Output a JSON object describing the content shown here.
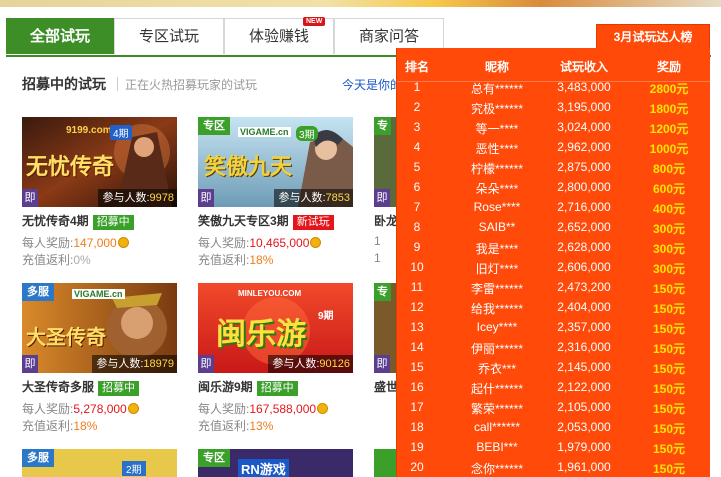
{
  "tabs": [
    {
      "label": "全部试玩",
      "active": true
    },
    {
      "label": "专区试玩",
      "active": false
    },
    {
      "label": "体验赚钱",
      "active": false,
      "badge": "NEW"
    },
    {
      "label": "商家问答",
      "active": false
    }
  ],
  "ranking_tab": "3月试玩达人榜",
  "section": {
    "title": "招募中的试玩",
    "subtitle": "正在火热招募玩家的试玩",
    "today_link": "今天是你的"
  },
  "labels": {
    "participants": "参与人数:",
    "reward": "每人奖励:",
    "rebate": "充值返利:",
    "ji": "即"
  },
  "cards": [
    {
      "name": "无忧传奇4期",
      "status": "招募中",
      "participants": "9978",
      "reward": "147,000",
      "rebate": "0%",
      "badge": "",
      "art_text": "无忧传奇",
      "period": "4期",
      "logo": "9199.com"
    },
    {
      "name": "笑傲九天专区3期",
      "status": "新试玩",
      "participants": "7853",
      "reward": "10,465,000",
      "rebate": "18%",
      "badge": "专区",
      "art_text": "笑傲九天",
      "period": "3期",
      "logo": "VIGAME.cn"
    },
    {
      "name": "大圣传奇多服",
      "status": "招募中",
      "participants": "18979",
      "reward": "5,278,000",
      "rebate": "18%",
      "badge": "多服",
      "art_text": "大圣传奇",
      "period": "",
      "logo": "VIGAME.cn"
    },
    {
      "name": "闽乐游9期",
      "status": "招募中",
      "participants": "90126",
      "reward": "167,588,000",
      "rebate": "13%",
      "badge": "",
      "art_text": "闽乐游",
      "period": "9期",
      "logo": "MINLEYOU.COM"
    }
  ],
  "partial_cards": [
    {
      "name": "卧龙",
      "reward": "1",
      "rebate": "1",
      "badge": "专"
    },
    {
      "name": "盛世",
      "reward": "",
      "rebate": "",
      "badge": "专"
    }
  ],
  "bottom_row": [
    {
      "badge": "多服",
      "period": "2期"
    },
    {
      "badge": "专区",
      "logo": "RN游戏"
    }
  ],
  "leaderboard": {
    "headers": [
      "排名",
      "昵称",
      "试玩收入",
      "奖励"
    ],
    "rows": [
      {
        "rank": "1",
        "name": "总有******",
        "income": "3,483,000",
        "reward": "2800元"
      },
      {
        "rank": "2",
        "name": "究极******",
        "income": "3,195,000",
        "reward": "1800元"
      },
      {
        "rank": "3",
        "name": "等一****",
        "income": "3,024,000",
        "reward": "1200元"
      },
      {
        "rank": "4",
        "name": "恶性****",
        "income": "2,962,000",
        "reward": "1000元"
      },
      {
        "rank": "5",
        "name": "柠檬******",
        "income": "2,875,000",
        "reward": "800元"
      },
      {
        "rank": "6",
        "name": "朵朵****",
        "income": "2,800,000",
        "reward": "600元"
      },
      {
        "rank": "7",
        "name": "Rose****",
        "income": "2,716,000",
        "reward": "400元"
      },
      {
        "rank": "8",
        "name": "SAIB**",
        "income": "2,652,000",
        "reward": "300元"
      },
      {
        "rank": "9",
        "name": "我是****",
        "income": "2,628,000",
        "reward": "300元"
      },
      {
        "rank": "10",
        "name": "旧灯****",
        "income": "2,606,000",
        "reward": "300元"
      },
      {
        "rank": "11",
        "name": "李雷******",
        "income": "2,473,200",
        "reward": "150元"
      },
      {
        "rank": "12",
        "name": "给我******",
        "income": "2,404,000",
        "reward": "150元"
      },
      {
        "rank": "13",
        "name": "Icey****",
        "income": "2,357,000",
        "reward": "150元"
      },
      {
        "rank": "14",
        "name": "伊丽******",
        "income": "2,316,000",
        "reward": "150元"
      },
      {
        "rank": "15",
        "name": "乔衣***",
        "income": "2,145,000",
        "reward": "150元"
      },
      {
        "rank": "16",
        "name": "起什******",
        "income": "2,122,000",
        "reward": "150元"
      },
      {
        "rank": "17",
        "name": "繁荣******",
        "income": "2,105,000",
        "reward": "150元"
      },
      {
        "rank": "18",
        "name": "call******",
        "income": "2,053,000",
        "reward": "150元"
      },
      {
        "rank": "19",
        "name": "BEBI***",
        "income": "1,979,000",
        "reward": "150元"
      },
      {
        "rank": "20",
        "name": "念你******",
        "income": "1,961,000",
        "reward": "150元"
      }
    ]
  },
  "colors": {
    "tab_active": "#3e8e27",
    "leaderboard_bg": "#ff4a0a",
    "reward_yellow": "#ffe400",
    "status_green": "#3aa02a",
    "status_red": "#e5161b"
  }
}
